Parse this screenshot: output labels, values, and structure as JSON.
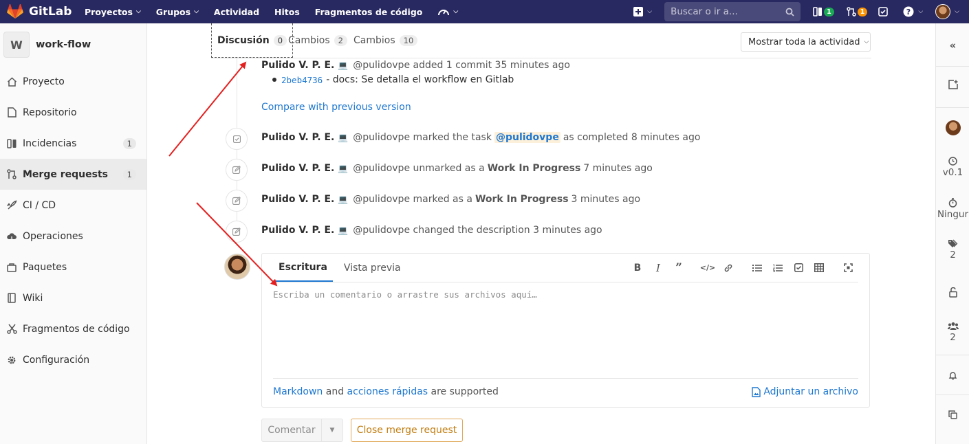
{
  "brand": {
    "name": "GitLab"
  },
  "nav": {
    "items": [
      {
        "label": "Proyectos",
        "has_dropdown": true
      },
      {
        "label": "Grupos",
        "has_dropdown": true
      },
      {
        "label": "Actividad",
        "has_dropdown": false
      },
      {
        "label": "Hitos",
        "has_dropdown": false
      },
      {
        "label": "Fragmentos de código",
        "has_dropdown": false
      }
    ],
    "search_placeholder": "Buscar o ir a...",
    "issues_count": "1",
    "mr_count": "1",
    "colors": {
      "bar": "#292961",
      "issues_badge": "#1aaa55",
      "mr_badge": "#fc9403"
    }
  },
  "sidebar": {
    "project_initial": "W",
    "project_name": "work-flow",
    "items": [
      {
        "label": "Proyecto",
        "icon": "home-icon"
      },
      {
        "label": "Repositorio",
        "icon": "doc-icon"
      },
      {
        "label": "Incidencias",
        "icon": "issues-icon",
        "count": "1"
      },
      {
        "label": "Merge requests",
        "icon": "merge-icon",
        "count": "1",
        "active": true
      },
      {
        "label": "CI / CD",
        "icon": "rocket-icon"
      },
      {
        "label": "Operaciones",
        "icon": "cloud-icon"
      },
      {
        "label": "Paquetes",
        "icon": "package-icon"
      },
      {
        "label": "Wiki",
        "icon": "book-icon"
      },
      {
        "label": "Fragmentos de código",
        "icon": "scissors-icon"
      },
      {
        "label": "Configuración",
        "icon": "gear-icon"
      }
    ]
  },
  "tabs": [
    {
      "label": "Discusión",
      "count": "0",
      "active": true
    },
    {
      "label": "Cambios",
      "count": "2"
    },
    {
      "label": "Cambios",
      "count": "10"
    }
  ],
  "activity_filter": "Mostrar toda la actividad",
  "timeline": {
    "author": "Pulido V. P. E.",
    "commit_note": {
      "handle": "@pulidovpe",
      "text": "added 1 commit 35 minutes ago"
    },
    "commit": {
      "sha": "2beb4736",
      "message": "- docs: Se detalla el workflow en Gitlab"
    },
    "compare_link": "Compare with previous version",
    "notes": [
      {
        "handle": "@pulidovpe",
        "pre": "marked the task",
        "mention": "@pulidovpe",
        "post": "as completed 8 minutes ago"
      },
      {
        "handle": "@pulidovpe",
        "pre": "unmarked as a",
        "strong": "Work In Progress",
        "post": "7 minutes ago"
      },
      {
        "handle": "@pulidovpe",
        "pre": "marked as a",
        "strong": "Work In Progress",
        "post": "3 minutes ago"
      },
      {
        "handle": "@pulidovpe",
        "pre": "changed the description 3 minutes ago"
      }
    ]
  },
  "comment_form": {
    "tab_write": "Escritura",
    "tab_preview": "Vista previa",
    "placeholder": "Escriba un comentario o arrastre sus archivos aquí…",
    "footer_markdown": "Markdown",
    "footer_and": "and",
    "footer_quick": "acciones rápidas",
    "footer_supported": "are supported",
    "attach": "Adjuntar un archivo",
    "toolbar": [
      "bold-icon",
      "italic-icon",
      "quote-icon",
      "code-icon",
      "link-icon",
      "bullet-list-icon",
      "numbered-list-icon",
      "task-list-icon",
      "table-icon",
      "fullscreen-icon"
    ]
  },
  "buttons": {
    "comment": "Comentar",
    "close_mr": "Close merge request"
  },
  "right_sidebar": {
    "milestone": "v0.1",
    "time_tracking": "Ningur",
    "labels_count": "2",
    "participants_count": "2"
  }
}
